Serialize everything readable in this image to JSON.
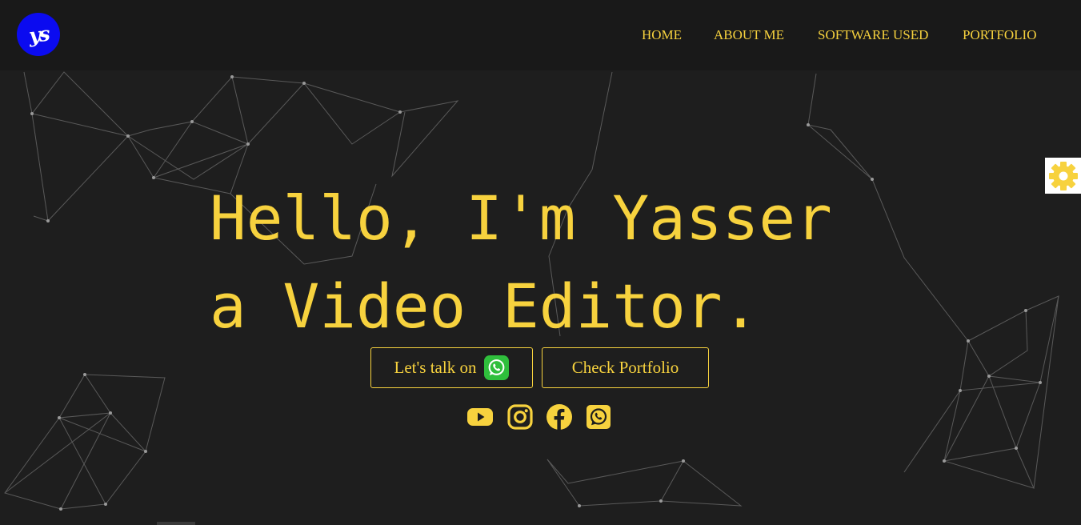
{
  "logo": {
    "text": "ys",
    "color": "#0b0bf0"
  },
  "nav": {
    "items": [
      {
        "label": "HOME"
      },
      {
        "label": "ABOUT ME"
      },
      {
        "label": "SOFTWARE USED"
      },
      {
        "label": "PORTFOLIO"
      }
    ]
  },
  "hero": {
    "line1": "Hello, I'm Yasser",
    "line2": "a Video Editor."
  },
  "buttons": {
    "talk_label": "Let's talk on",
    "talk_icon": "whatsapp-icon",
    "portfolio_label": "Check Portfolio"
  },
  "social": [
    "youtube-icon",
    "instagram-icon",
    "facebook-icon",
    "whatsapp-icon"
  ],
  "settings_icon": "gear-icon",
  "colors": {
    "accent": "#f7d23e",
    "background": "#1e1e1e",
    "navbar": "#191919",
    "whatsapp_green": "#2fbf3c"
  }
}
